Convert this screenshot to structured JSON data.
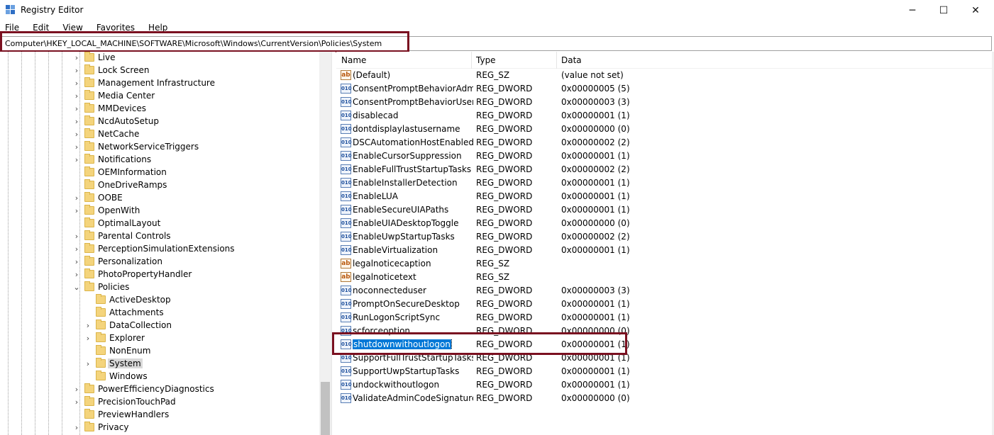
{
  "window": {
    "title": "Registry Editor",
    "controls": {
      "minimize": "─",
      "maximize": "☐",
      "close": "✕"
    }
  },
  "menu": [
    "File",
    "Edit",
    "View",
    "Favorites",
    "Help"
  ],
  "address": "Computer\\HKEY_LOCAL_MACHINE\\SOFTWARE\\Microsoft\\Windows\\CurrentVersion\\Policies\\System",
  "tree": {
    "items": [
      {
        "label": "Live",
        "level": 1,
        "expander": "collapsed"
      },
      {
        "label": "Lock Screen",
        "level": 1,
        "expander": "collapsed"
      },
      {
        "label": "Management Infrastructure",
        "level": 1,
        "expander": "collapsed"
      },
      {
        "label": "Media Center",
        "level": 1,
        "expander": "collapsed"
      },
      {
        "label": "MMDevices",
        "level": 1,
        "expander": "collapsed"
      },
      {
        "label": "NcdAutoSetup",
        "level": 1,
        "expander": "collapsed"
      },
      {
        "label": "NetCache",
        "level": 1,
        "expander": "collapsed"
      },
      {
        "label": "NetworkServiceTriggers",
        "level": 1,
        "expander": "collapsed"
      },
      {
        "label": "Notifications",
        "level": 1,
        "expander": "collapsed"
      },
      {
        "label": "OEMInformation",
        "level": 1,
        "expander": "none"
      },
      {
        "label": "OneDriveRamps",
        "level": 1,
        "expander": "none"
      },
      {
        "label": "OOBE",
        "level": 1,
        "expander": "collapsed"
      },
      {
        "label": "OpenWith",
        "level": 1,
        "expander": "collapsed"
      },
      {
        "label": "OptimalLayout",
        "level": 1,
        "expander": "none"
      },
      {
        "label": "Parental Controls",
        "level": 1,
        "expander": "collapsed"
      },
      {
        "label": "PerceptionSimulationExtensions",
        "level": 1,
        "expander": "collapsed"
      },
      {
        "label": "Personalization",
        "level": 1,
        "expander": "collapsed"
      },
      {
        "label": "PhotoPropertyHandler",
        "level": 1,
        "expander": "collapsed"
      },
      {
        "label": "Policies",
        "level": 1,
        "expander": "expanded"
      },
      {
        "label": "ActiveDesktop",
        "level": 2,
        "expander": "none"
      },
      {
        "label": "Attachments",
        "level": 2,
        "expander": "none"
      },
      {
        "label": "DataCollection",
        "level": 2,
        "expander": "collapsed"
      },
      {
        "label": "Explorer",
        "level": 2,
        "expander": "collapsed"
      },
      {
        "label": "NonEnum",
        "level": 2,
        "expander": "none"
      },
      {
        "label": "System",
        "level": 2,
        "expander": "collapsed",
        "selected": true
      },
      {
        "label": "Windows",
        "level": 2,
        "expander": "none"
      },
      {
        "label": "PowerEfficiencyDiagnostics",
        "level": 1,
        "expander": "collapsed"
      },
      {
        "label": "PrecisionTouchPad",
        "level": 1,
        "expander": "collapsed"
      },
      {
        "label": "PreviewHandlers",
        "level": 1,
        "expander": "none"
      },
      {
        "label": "Privacy",
        "level": 1,
        "expander": "collapsed"
      }
    ]
  },
  "list": {
    "columns": {
      "name": "Name",
      "type": "Type",
      "data": "Data"
    },
    "rows": [
      {
        "name": "(Default)",
        "type": "REG_SZ",
        "data": "(value not set)",
        "icon": "string-value-icon"
      },
      {
        "name": "ConsentPromptBehaviorAdmin",
        "type": "REG_DWORD",
        "data": "0x00000005 (5)",
        "icon": "dword-value-icon"
      },
      {
        "name": "ConsentPromptBehaviorUser",
        "type": "REG_DWORD",
        "data": "0x00000003 (3)",
        "icon": "dword-value-icon"
      },
      {
        "name": "disablecad",
        "type": "REG_DWORD",
        "data": "0x00000001 (1)",
        "icon": "dword-value-icon"
      },
      {
        "name": "dontdisplaylastusername",
        "type": "REG_DWORD",
        "data": "0x00000000 (0)",
        "icon": "dword-value-icon"
      },
      {
        "name": "DSCAutomationHostEnabled",
        "type": "REG_DWORD",
        "data": "0x00000002 (2)",
        "icon": "dword-value-icon"
      },
      {
        "name": "EnableCursorSuppression",
        "type": "REG_DWORD",
        "data": "0x00000001 (1)",
        "icon": "dword-value-icon"
      },
      {
        "name": "EnableFullTrustStartupTasks",
        "type": "REG_DWORD",
        "data": "0x00000002 (2)",
        "icon": "dword-value-icon"
      },
      {
        "name": "EnableInstallerDetection",
        "type": "REG_DWORD",
        "data": "0x00000001 (1)",
        "icon": "dword-value-icon"
      },
      {
        "name": "EnableLUA",
        "type": "REG_DWORD",
        "data": "0x00000001 (1)",
        "icon": "dword-value-icon"
      },
      {
        "name": "EnableSecureUIAPaths",
        "type": "REG_DWORD",
        "data": "0x00000001 (1)",
        "icon": "dword-value-icon"
      },
      {
        "name": "EnableUIADesktopToggle",
        "type": "REG_DWORD",
        "data": "0x00000000 (0)",
        "icon": "dword-value-icon"
      },
      {
        "name": "EnableUwpStartupTasks",
        "type": "REG_DWORD",
        "data": "0x00000002 (2)",
        "icon": "dword-value-icon"
      },
      {
        "name": "EnableVirtualization",
        "type": "REG_DWORD",
        "data": "0x00000001 (1)",
        "icon": "dword-value-icon"
      },
      {
        "name": "legalnoticecaption",
        "type": "REG_SZ",
        "data": "",
        "icon": "string-value-icon"
      },
      {
        "name": "legalnoticetext",
        "type": "REG_SZ",
        "data": "",
        "icon": "string-value-icon"
      },
      {
        "name": "noconnecteduser",
        "type": "REG_DWORD",
        "data": "0x00000003 (3)",
        "icon": "dword-value-icon"
      },
      {
        "name": "PromptOnSecureDesktop",
        "type": "REG_DWORD",
        "data": "0x00000001 (1)",
        "icon": "dword-value-icon"
      },
      {
        "name": "RunLogonScriptSync",
        "type": "REG_DWORD",
        "data": "0x00000001 (1)",
        "icon": "dword-value-icon"
      },
      {
        "name": "scforceoption",
        "type": "REG_DWORD",
        "data": "0x00000000 (0)",
        "icon": "dword-value-icon"
      },
      {
        "name": "shutdownwithoutlogon",
        "type": "REG_DWORD",
        "data": "0x00000001 (1)",
        "icon": "dword-value-icon",
        "selected": true
      },
      {
        "name": "SupportFullTrustStartupTasks",
        "type": "REG_DWORD",
        "data": "0x00000001 (1)",
        "icon": "dword-value-icon"
      },
      {
        "name": "SupportUwpStartupTasks",
        "type": "REG_DWORD",
        "data": "0x00000001 (1)",
        "icon": "dword-value-icon"
      },
      {
        "name": "undockwithoutlogon",
        "type": "REG_DWORD",
        "data": "0x00000001 (1)",
        "icon": "dword-value-icon"
      },
      {
        "name": "ValidateAdminCodeSignatures",
        "type": "REG_DWORD",
        "data": "0x00000000 (0)",
        "icon": "dword-value-icon"
      }
    ]
  },
  "colors": {
    "highlight_box": "#7a1020",
    "selection": "#0078d7",
    "folder": "#f4d47c"
  }
}
